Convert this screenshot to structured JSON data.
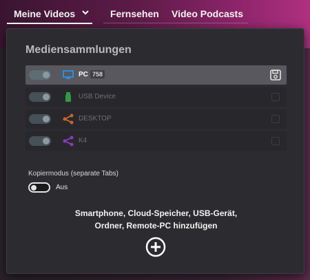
{
  "nav": {
    "tabs": [
      {
        "label": "Meine Videos",
        "active": true
      },
      {
        "label": "Fernsehen"
      },
      {
        "label": "Video Podcasts"
      }
    ]
  },
  "panel": {
    "title": "Mediensammlungen",
    "devices": [
      {
        "label": "PC",
        "badge": "758",
        "icon": "monitor-icon",
        "color": "#2a8ee0",
        "selected": true
      },
      {
        "label": "USB Device",
        "icon": "usb-icon",
        "color": "#2f9a46"
      },
      {
        "label": "DESKTOP",
        "icon": "share-icon",
        "color": "#c7662a"
      },
      {
        "label": "K4",
        "icon": "share-icon",
        "color": "#8b3ab8"
      }
    ],
    "copy_mode": {
      "label": "Kopiermodus (separate Tabs)",
      "state": "Aus",
      "on": false
    },
    "add": {
      "line1": "Smartphone, Cloud-Speicher, USB-Gerät,",
      "line2": "Ordner, Remote-PC hinzufügen"
    }
  },
  "colors": {
    "accent_gradient_end": "#b03080",
    "pc_icon": "#2a8ee0",
    "usb_icon": "#2f9a46",
    "desktop_icon": "#c7662a",
    "k4_icon": "#8b3ab8"
  }
}
